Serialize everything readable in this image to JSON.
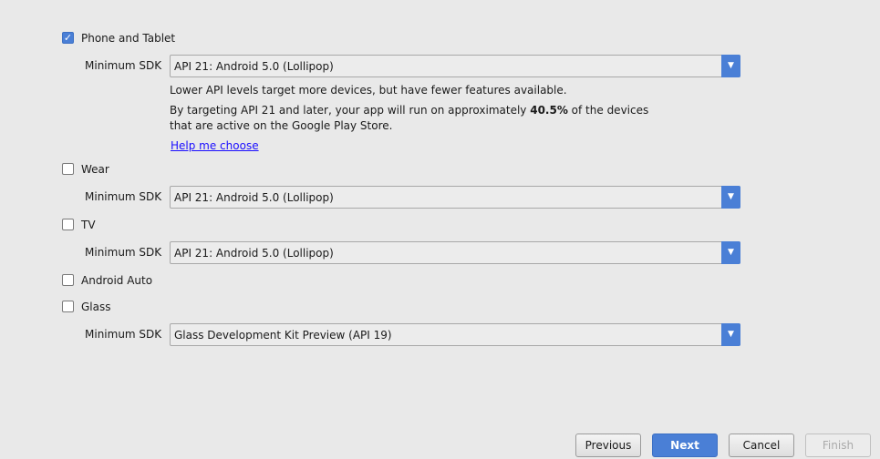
{
  "phone": {
    "label": "Phone and Tablet",
    "checked": true,
    "sdk_label": "Minimum SDK",
    "sdk_value": "API 21: Android 5.0 (Lollipop)",
    "info1": "Lower API levels target more devices, but have fewer features available.",
    "info2_pre": "By targeting API 21 and later, your app will run on approximately ",
    "info2_bold": "40.5%",
    "info2_post": " of the devices",
    "info3": "that are active on the Google Play Store.",
    "help_link": "Help me choose"
  },
  "wear": {
    "label": "Wear",
    "checked": false,
    "sdk_label": "Minimum SDK",
    "sdk_value": "API 21: Android 5.0 (Lollipop)"
  },
  "tv": {
    "label": "TV",
    "checked": false,
    "sdk_label": "Minimum SDK",
    "sdk_value": "API 21: Android 5.0 (Lollipop)"
  },
  "auto": {
    "label": "Android Auto",
    "checked": false
  },
  "glass": {
    "label": "Glass",
    "checked": false,
    "sdk_label": "Minimum SDK",
    "sdk_value": "Glass Development Kit Preview (API 19)"
  },
  "buttons": {
    "previous": "Previous",
    "next": "Next",
    "cancel": "Cancel",
    "finish": "Finish"
  },
  "colors": {
    "accent": "#4a7fd6",
    "link": "#1a0dff",
    "background": "#e9e9e9"
  }
}
